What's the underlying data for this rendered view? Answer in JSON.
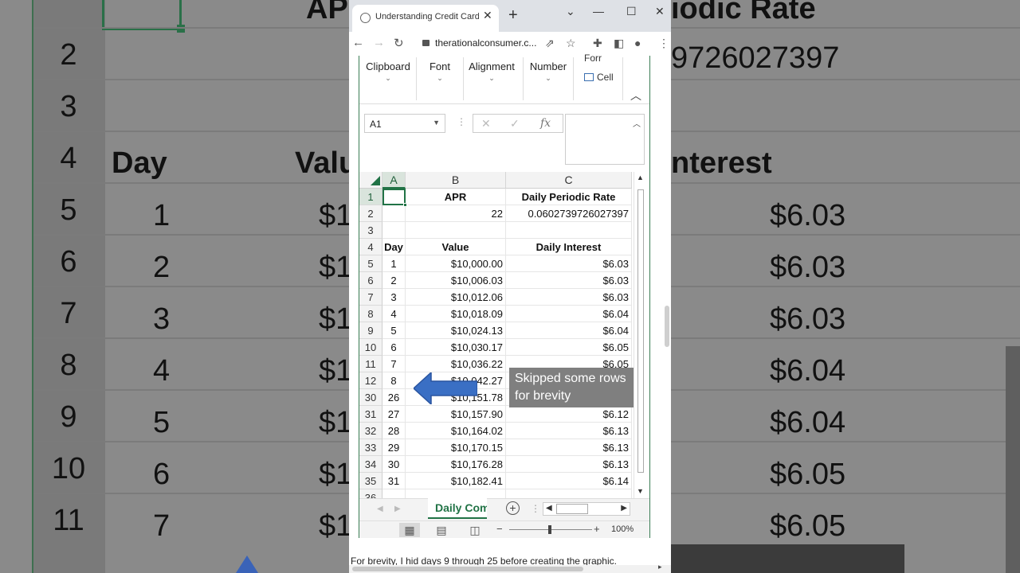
{
  "background": {
    "row_numbers": [
      "2",
      "3",
      "4",
      "5",
      "6",
      "7",
      "8",
      "9",
      "10",
      "11"
    ],
    "header_apr": "AP",
    "header_rate": "iodic Rate",
    "rate_value": "9726027397",
    "label_day": "Day",
    "label_value": "Valu",
    "label_interest": "nterest",
    "days": [
      "1",
      "2",
      "3",
      "4",
      "5",
      "6",
      "7"
    ],
    "value_prefix": "$1",
    "interests": [
      "$6.03",
      "$6.03",
      "$6.03",
      "$6.04",
      "$6.04",
      "$6.05",
      "$6.05"
    ]
  },
  "browser": {
    "tab_title": "Understanding Credit Card Int",
    "url": "therationalconsumer.c..."
  },
  "ribbon": {
    "groups": [
      "Clipboard",
      "Font",
      "Alignment",
      "Number"
    ],
    "styles": [
      "Forr",
      "Cell"
    ]
  },
  "formula": {
    "name_box": "A1",
    "fx": "fx"
  },
  "sheet": {
    "columns": [
      "A",
      "B",
      "C"
    ],
    "rows": [
      {
        "r": "1",
        "a": "",
        "b": "APR",
        "c": "Daily Periodic Rate",
        "header": true
      },
      {
        "r": "2",
        "a": "",
        "b": "22",
        "c": "0.0602739726027397",
        "header": false
      },
      {
        "r": "3",
        "a": "",
        "b": "",
        "c": "",
        "header": false
      },
      {
        "r": "4",
        "a": "Day",
        "b": "Value",
        "c": "Daily Interest",
        "header": true
      },
      {
        "r": "5",
        "a": "1",
        "b": "$10,000.00",
        "c": "$6.03",
        "header": false
      },
      {
        "r": "6",
        "a": "2",
        "b": "$10,006.03",
        "c": "$6.03",
        "header": false
      },
      {
        "r": "7",
        "a": "3",
        "b": "$10,012.06",
        "c": "$6.03",
        "header": false
      },
      {
        "r": "8",
        "a": "4",
        "b": "$10,018.09",
        "c": "$6.04",
        "header": false
      },
      {
        "r": "9",
        "a": "5",
        "b": "$10,024.13",
        "c": "$6.04",
        "header": false
      },
      {
        "r": "10",
        "a": "6",
        "b": "$10,030.17",
        "c": "$6.05",
        "header": false
      },
      {
        "r": "11",
        "a": "7",
        "b": "$10,036.22",
        "c": "$6.05",
        "header": false
      },
      {
        "r": "12",
        "a": "8",
        "b": "$10,042.27",
        "c": "",
        "header": false
      },
      {
        "r": "30",
        "a": "26",
        "b": "$10,151.78",
        "c": "",
        "header": false
      },
      {
        "r": "31",
        "a": "27",
        "b": "$10,157.90",
        "c": "$6.12",
        "header": false
      },
      {
        "r": "32",
        "a": "28",
        "b": "$10,164.02",
        "c": "$6.13",
        "header": false
      },
      {
        "r": "33",
        "a": "29",
        "b": "$10,170.15",
        "c": "$6.13",
        "header": false
      },
      {
        "r": "34",
        "a": "30",
        "b": "$10,176.28",
        "c": "$6.13",
        "header": false
      },
      {
        "r": "35",
        "a": "31",
        "b": "$10,182.41",
        "c": "$6.14",
        "header": false
      },
      {
        "r": "36",
        "a": "",
        "b": "",
        "c": "",
        "header": false
      }
    ],
    "tab_name": "Daily Com",
    "zoom": "100%"
  },
  "annotation": {
    "note": "Skipped some rows for brevity",
    "arrow_color": "#3a6fc4"
  },
  "caption": "For brevity, I hid days 9 through 25 before creating the graphic.",
  "colors": {
    "excel_green": "#217346",
    "note_bg": "#7f7f7f"
  }
}
